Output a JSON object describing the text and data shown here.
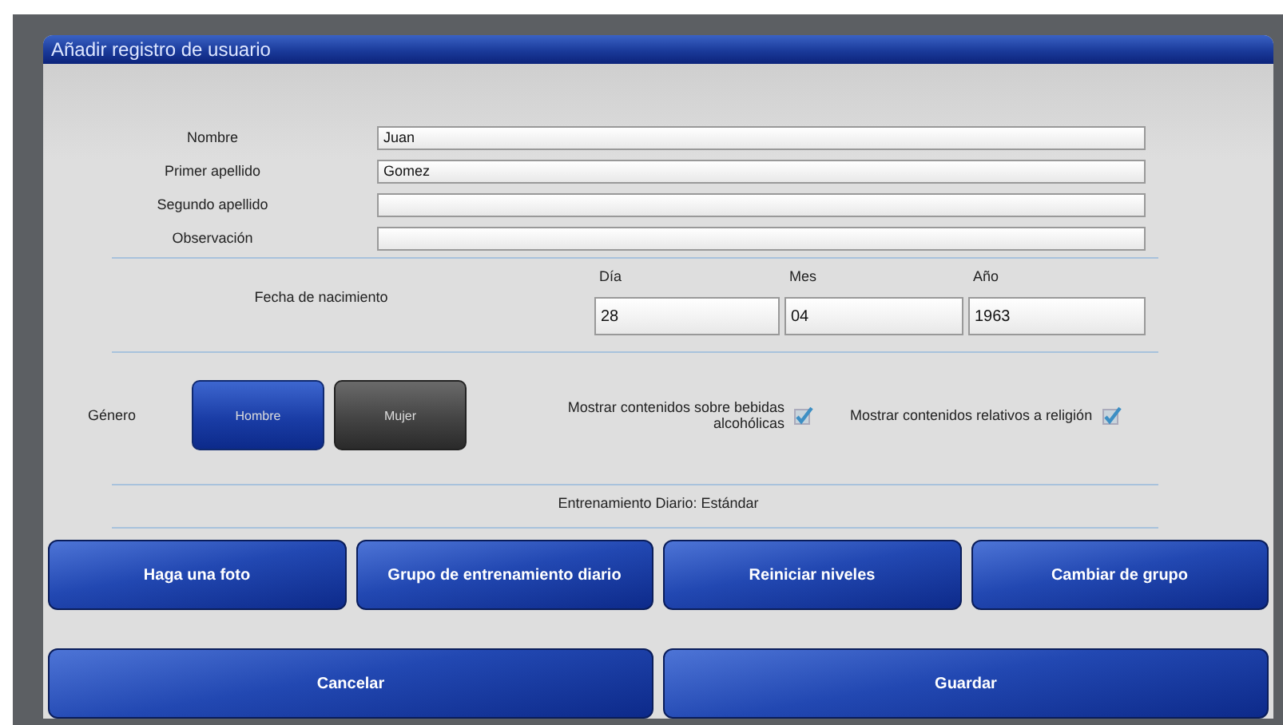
{
  "dialog": {
    "title": "Añadir registro de usuario"
  },
  "fields": [
    {
      "label": "Nombre",
      "value": "Juan"
    },
    {
      "label": "Primer apellido",
      "value": "Gomez"
    },
    {
      "label": "Segundo apellido"
    },
    {
      "label": "Observación"
    }
  ],
  "birth_date": {
    "label": "Fecha de nacimiento",
    "parts": [
      {
        "label": "Día",
        "value": "28"
      },
      {
        "label": "Mes",
        "value": "04"
      },
      {
        "label": "Año",
        "value": "1963"
      }
    ]
  },
  "gender": {
    "label": "Género",
    "options": [
      {
        "label": "Hombre",
        "selected": true
      },
      {
        "label": "Mujer",
        "selected": false
      }
    ]
  },
  "options": [
    {
      "label": "Mostrar contenidos sobre bebidas alcohólicas",
      "checked": true
    },
    {
      "label": "Mostrar contenidos relativos a religión",
      "checked": true
    }
  ],
  "training": "Entrenamiento Diario: Estándar",
  "action_buttons": [
    "Haga una foto",
    "Grupo de entrenamiento diario",
    "Reiniciar niveles",
    "Cambiar de grupo"
  ],
  "footer_buttons": [
    "Cancelar",
    "Guardar"
  ]
}
